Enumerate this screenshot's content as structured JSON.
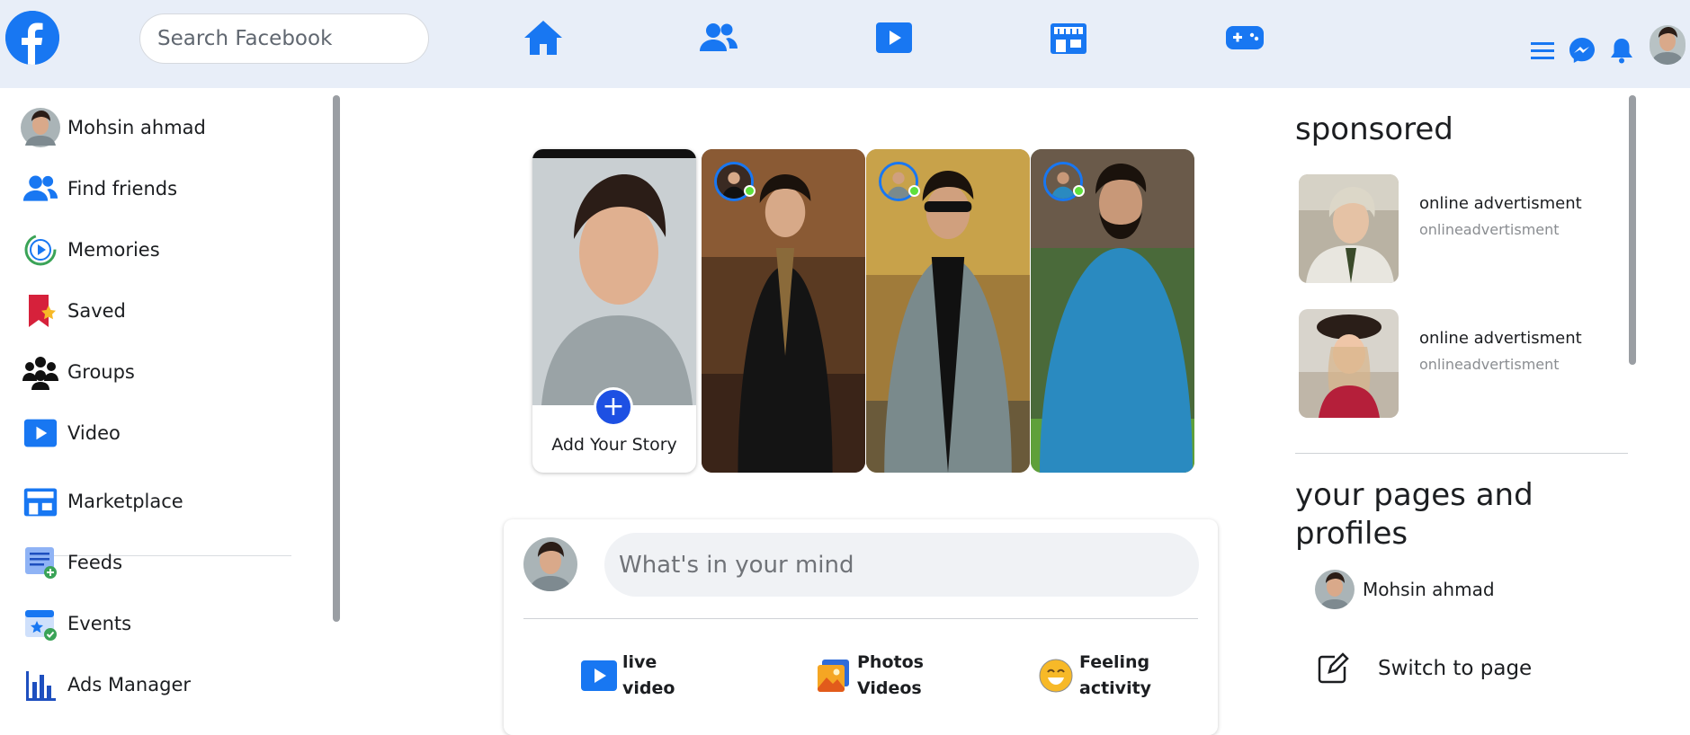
{
  "header": {
    "search_placeholder": "Search Facebook",
    "nav": [
      "home-icon",
      "friends-icon",
      "watch-icon",
      "marketplace-icon",
      "gaming-icon"
    ],
    "right_icons": [
      "menu-icon",
      "messenger-icon",
      "notifications-icon"
    ],
    "accent": "#1877f2"
  },
  "sidebar": {
    "items": [
      {
        "label": "Mohsin ahmad",
        "icon": "profile-avatar"
      },
      {
        "label": "Find friends",
        "icon": "friends-icon"
      },
      {
        "label": "Memories",
        "icon": "memories-icon"
      },
      {
        "label": "Saved",
        "icon": "saved-icon"
      },
      {
        "label": "Groups",
        "icon": "groups-icon"
      },
      {
        "label": "Video",
        "icon": "video-icon"
      },
      {
        "label": "Marketplace",
        "icon": "marketplace-icon"
      },
      {
        "label": "Feeds",
        "icon": "feeds-icon"
      },
      {
        "label": "Events",
        "icon": "events-icon"
      },
      {
        "label": "Ads Manager",
        "icon": "ads-manager-icon"
      }
    ]
  },
  "stories": {
    "add_label": "Add Your Story",
    "add_symbol": "+"
  },
  "composer": {
    "placeholder": "What's in your mind",
    "actions": [
      {
        "line1": "live",
        "line2": "video",
        "icon": "live-video-icon"
      },
      {
        "line1": "Photos",
        "line2": "Videos",
        "icon": "photos-icon"
      },
      {
        "line1": "Feeling",
        "line2": "activity",
        "icon": "feeling-icon"
      }
    ]
  },
  "right": {
    "sponsored_title": "sponsored",
    "ads": [
      {
        "title": "online advertisment",
        "subtitle": "onlineadvertisment"
      },
      {
        "title": "online advertisment",
        "subtitle": "onlineadvertisment"
      }
    ],
    "pages_title_line1": "your pages and",
    "pages_title_line2": "profiles",
    "page_name": "Mohsin ahmad",
    "switch_label": "Switch to page"
  }
}
